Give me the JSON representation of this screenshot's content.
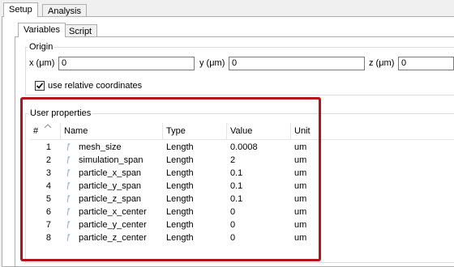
{
  "outer_tabs": [
    {
      "label": "Setup",
      "active": true
    },
    {
      "label": "Analysis",
      "active": false
    }
  ],
  "inner_tabs": [
    {
      "label": "Variables",
      "active": true
    },
    {
      "label": "Script",
      "active": false
    }
  ],
  "origin": {
    "title": "Origin",
    "x_label": "x (μm)",
    "x_value": "0",
    "y_label": "y (μm)",
    "y_value": "0",
    "z_label": "z (μm)",
    "z_value": "0",
    "relative_label": "use relative coordinates",
    "relative_checked": true
  },
  "user_properties": {
    "title": "User properties",
    "columns": [
      "#",
      "Name",
      "Type",
      "Value",
      "Unit"
    ],
    "rows": [
      {
        "num": "1",
        "name": "mesh_size",
        "type": "Length",
        "value": "0.0008",
        "unit": "um"
      },
      {
        "num": "2",
        "name": "simulation_span",
        "type": "Length",
        "value": "2",
        "unit": "um"
      },
      {
        "num": "3",
        "name": "particle_x_span",
        "type": "Length",
        "value": "0.1",
        "unit": "um"
      },
      {
        "num": "4",
        "name": "particle_y_span",
        "type": "Length",
        "value": "0.1",
        "unit": "um"
      },
      {
        "num": "5",
        "name": "particle_z_span",
        "type": "Length",
        "value": "0.1",
        "unit": "um"
      },
      {
        "num": "6",
        "name": "particle_x_center",
        "type": "Length",
        "value": "0",
        "unit": "um"
      },
      {
        "num": "7",
        "name": "particle_y_center",
        "type": "Length",
        "value": "0",
        "unit": "um"
      },
      {
        "num": "8",
        "name": "particle_z_center",
        "type": "Length",
        "value": "0",
        "unit": "um"
      }
    ],
    "icon": "variable-icon"
  },
  "colors": {
    "highlight": "#b5121b",
    "icon": "#7aa7d8"
  }
}
